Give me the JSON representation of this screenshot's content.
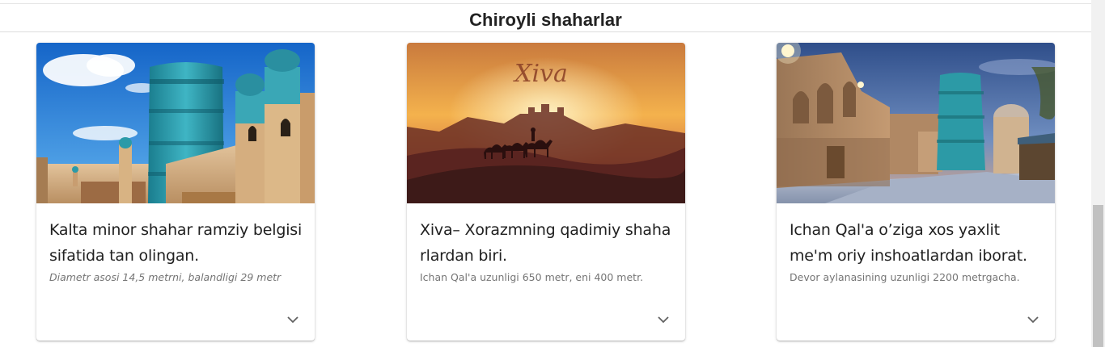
{
  "header": {
    "title": "Chiroyli shaharlar"
  },
  "cards": [
    {
      "title": "Kalta minor shahar ramziy belgisi sifatida tan olingan.",
      "subtitle": "Diametr asosi 14,5 metrni, balandligi 29 metr",
      "image_icon": "kalta-minor-photo"
    },
    {
      "title": "Xiva– Xorazmning qadimiy shaha rlardan biri.",
      "subtitle": "Ichan Qal'a uzunligi 650 metr, eni 400 metr.",
      "image_caption": "Xiva",
      "image_icon": "xiva-desert-illustration"
    },
    {
      "title": "Ichan Qal'a o’ziga xos yaxlit me'm oriy inshoatlardan iborat.",
      "subtitle": "Devor aylanasining uzunligi 2200 metrgacha.",
      "image_icon": "ichan-qala-street-photo"
    }
  ],
  "icons": {
    "expand": "chevron-down-icon"
  },
  "colors": {
    "title_text": "#222222",
    "body_text": "#212121",
    "secondary_text": "#757575"
  }
}
